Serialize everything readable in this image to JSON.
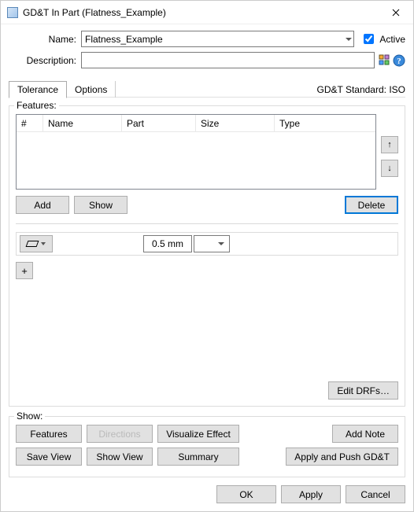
{
  "window": {
    "title": "GD&T In Part (Flatness_Example)"
  },
  "form": {
    "name_label": "Name:",
    "name_value": "Flatness_Example",
    "active_label": "Active",
    "active_checked": true,
    "description_label": "Description:",
    "description_value": ""
  },
  "tabs": {
    "tolerance": "Tolerance",
    "options": "Options",
    "active_index": 0
  },
  "standard_label": "GD&T Standard: ISO",
  "features": {
    "legend": "Features:",
    "columns": {
      "index": "#",
      "name": "Name",
      "part": "Part",
      "size": "Size",
      "type": "Type"
    },
    "rows": [],
    "buttons": {
      "add": "Add",
      "show": "Show",
      "delete": "Delete",
      "up": "↑",
      "down": "↓"
    }
  },
  "tolerance": {
    "symbol_name": "flatness",
    "value": "0.5 mm",
    "plus": "+"
  },
  "edit_drfs": "Edit DRFs…",
  "show_section": {
    "legend": "Show:",
    "features": "Features",
    "directions": "Directions",
    "visualize": "Visualize Effect",
    "add_note": "Add Note",
    "save_view": "Save View",
    "show_view": "Show View",
    "summary": "Summary",
    "apply_push": "Apply and Push GD&T"
  },
  "footer": {
    "ok": "OK",
    "apply": "Apply",
    "cancel": "Cancel"
  }
}
